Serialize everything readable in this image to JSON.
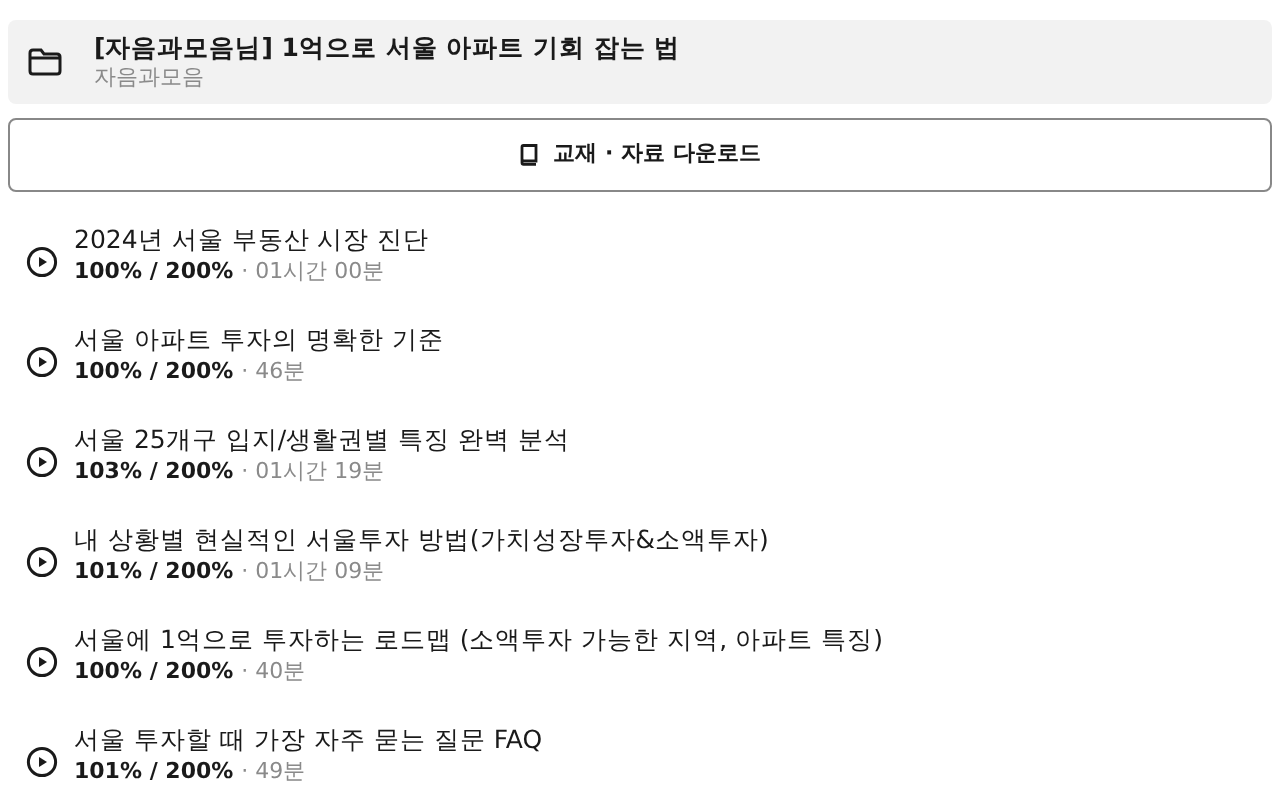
{
  "course": {
    "title": "[자음과모음님] 1억으로 서울 아파트 기회 잡는 법",
    "author": "자음과모음"
  },
  "download_button": {
    "label": "교재 · 자료 다운로드"
  },
  "lessons": [
    {
      "title": "2024년 서울 부동산 시장 진단",
      "progress": "100% / 200%",
      "duration": "· 01시간 00분"
    },
    {
      "title": "서울 아파트 투자의 명확한 기준",
      "progress": "100% / 200%",
      "duration": "· 46분"
    },
    {
      "title": "서울 25개구 입지/생활권별 특징 완벽 분석",
      "progress": "103% / 200%",
      "duration": "· 01시간 19분"
    },
    {
      "title": "내 상황별 현실적인 서울투자 방법(가치성장투자&소액투자)",
      "progress": "101% / 200%",
      "duration": "· 01시간 09분"
    },
    {
      "title": "서울에 1억으로 투자하는 로드맵 (소액투자 가능한 지역, 아파트 특징)",
      "progress": "100% / 200%",
      "duration": "· 40분"
    },
    {
      "title": "서울 투자할 때 가장 자주 묻는 질문 FAQ",
      "progress": "101% / 200%",
      "duration": "· 49분"
    }
  ]
}
